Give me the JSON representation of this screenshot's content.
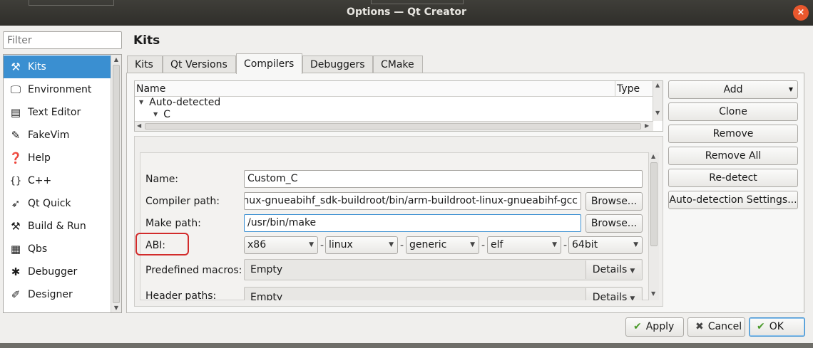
{
  "window": {
    "title": "Options — Qt Creator",
    "close_glyph": "×"
  },
  "filter": {
    "placeholder": "Filter"
  },
  "sidebar": {
    "items": [
      {
        "label": "Kits",
        "icon": "kits-icon",
        "glyph": "⚒"
      },
      {
        "label": "Environment",
        "icon": "monitor-icon",
        "glyph": "🖵"
      },
      {
        "label": "Text Editor",
        "icon": "text-editor-icon",
        "glyph": "▤"
      },
      {
        "label": "FakeVim",
        "icon": "fakevim-icon",
        "glyph": "✎"
      },
      {
        "label": "Help",
        "icon": "help-icon",
        "glyph": "❓"
      },
      {
        "label": "C++",
        "icon": "cpp-icon",
        "glyph": "{}"
      },
      {
        "label": "Qt Quick",
        "icon": "qt-quick-icon",
        "glyph": "➶"
      },
      {
        "label": "Build & Run",
        "icon": "hammer-icon",
        "glyph": "⚒"
      },
      {
        "label": "Qbs",
        "icon": "qbs-icon",
        "glyph": "▦"
      },
      {
        "label": "Debugger",
        "icon": "bug-icon",
        "glyph": "✱"
      },
      {
        "label": "Designer",
        "icon": "pen-icon",
        "glyph": "✐"
      }
    ],
    "selected": "Kits"
  },
  "page": {
    "title": "Kits"
  },
  "tabs": [
    "Kits",
    "Qt Versions",
    "Compilers",
    "Debuggers",
    "CMake"
  ],
  "active_tab": "Compilers",
  "tree": {
    "col_name": "Name",
    "col_type": "Type",
    "rows": [
      {
        "label": "Auto-detected",
        "level": 0
      },
      {
        "label": "C",
        "level": 1
      }
    ]
  },
  "side_buttons": {
    "add": "Add",
    "clone": "Clone",
    "remove": "Remove",
    "remove_all": "Remove All",
    "redetect": "Re-detect",
    "auto_detection_settings": "Auto-detection Settings..."
  },
  "form": {
    "name_label": "Name:",
    "name_value": "Custom_C",
    "compiler_path_label": "Compiler path:",
    "compiler_path_value": "linux-gnueabihf_sdk-buildroot/bin/arm-buildroot-linux-gnueabihf-gcc",
    "make_path_label": "Make path:",
    "make_path_value": "/usr/bin/make",
    "browse": "Browse...",
    "abi_label": "ABI:",
    "abi": [
      "x86",
      "linux",
      "generic",
      "elf",
      "64bit"
    ],
    "abi_sep": "-",
    "predefined_macros_label": "Predefined macros:",
    "predefined_macros_value": "Empty",
    "header_paths_label": "Header paths:",
    "header_paths_value": "Empty",
    "details": "Details"
  },
  "dialog_buttons": {
    "apply": "Apply",
    "cancel": "Cancel",
    "ok": "OK"
  },
  "colors": {
    "selection": "#3a8fd1",
    "highlight": "#d22b2b",
    "titlebar": "#2f2e2a"
  }
}
